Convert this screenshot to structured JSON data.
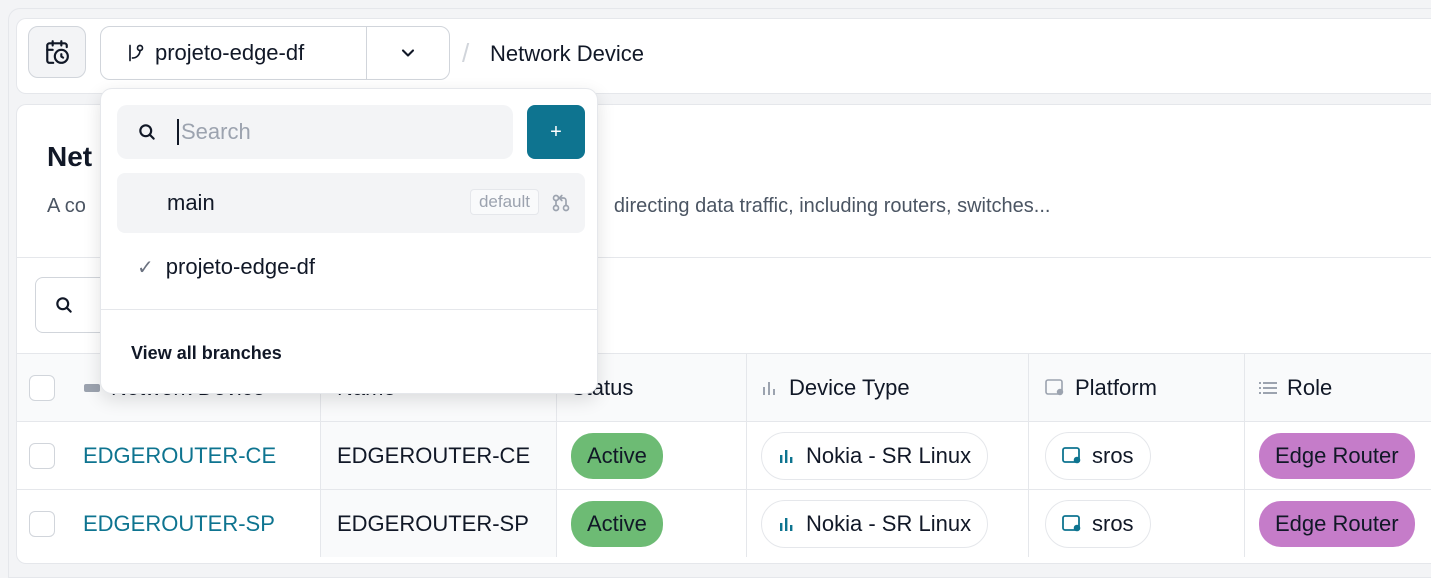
{
  "header": {
    "branch_name": "projeto-edge-df",
    "breadcrumb_separator": "/",
    "breadcrumb": "Network Device"
  },
  "page": {
    "title": "Network Device",
    "title_visible": "Net",
    "description_prefix": "A co",
    "description_suffix": "directing data traffic, including routers, switches..."
  },
  "table": {
    "columns": [
      {
        "label": "Network Device",
        "icon": "device-icon"
      },
      {
        "label": "Name"
      },
      {
        "label": "Status"
      },
      {
        "label": "Device Type",
        "icon": "bar-chart-icon"
      },
      {
        "label": "Platform",
        "icon": "platform-icon"
      },
      {
        "label": "Role",
        "icon": "list-icon"
      }
    ],
    "rows": [
      {
        "device": "EDGEROUTER-CE",
        "name": "EDGEROUTER-CE",
        "status": "Active",
        "device_type": "Nokia - SR Linux",
        "platform": "sros",
        "role": "Edge Router"
      },
      {
        "device": "EDGEROUTER-SP",
        "name": "EDGEROUTER-SP",
        "status": "Active",
        "device_type": "Nokia - SR Linux",
        "platform": "sros",
        "role": "Edge Router"
      }
    ]
  },
  "branch_dropdown": {
    "search_placeholder": "Search",
    "add_label": "+",
    "branches": [
      {
        "name": "main",
        "badge": "default"
      },
      {
        "name": "projeto-edge-df",
        "selected": true
      }
    ],
    "view_all_label": "View all branches"
  },
  "colors": {
    "accent": "#0e7490",
    "status_active": "#6dbb74",
    "role_badge": "#c57cc9"
  }
}
